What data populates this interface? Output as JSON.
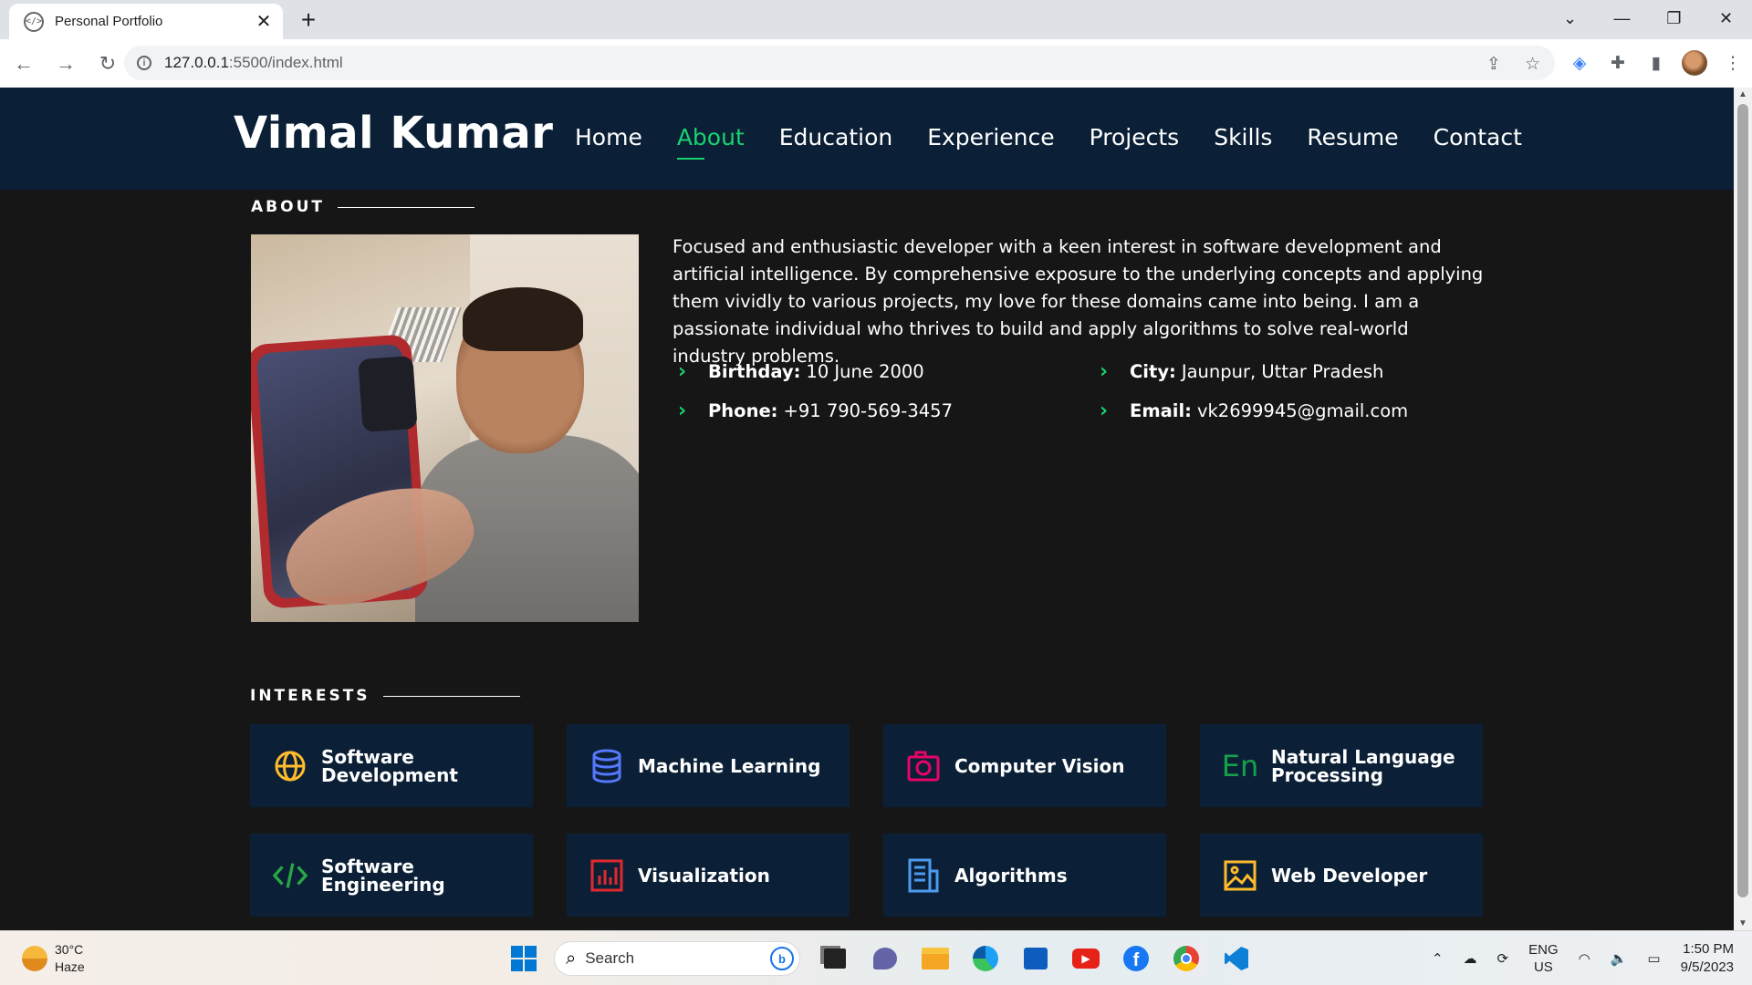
{
  "browser": {
    "tab_title": "Personal Portfolio",
    "tab_close": "✕",
    "new_tab": "+",
    "url_host": "127.0.0.1",
    "url_path": ":5500/index.html"
  },
  "site": {
    "brand": "Vimal Kumar",
    "nav": [
      {
        "label": "Home",
        "active": false
      },
      {
        "label": "About",
        "active": true
      },
      {
        "label": "Education",
        "active": false
      },
      {
        "label": "Experience",
        "active": false
      },
      {
        "label": "Projects",
        "active": false
      },
      {
        "label": "Skills",
        "active": false
      },
      {
        "label": "Resume",
        "active": false
      },
      {
        "label": "Contact",
        "active": false
      }
    ],
    "accent_color": "#18d26e",
    "header_color": "#0b2036"
  },
  "about": {
    "section_title": "ABOUT",
    "bio": "Focused and enthusiastic developer with a keen interest in software development and artificial intelligence. By comprehensive exposure to the underlying concepts and applying them vividly to various projects, my love for these domains came into being. I am a passionate individual who thrives to build and apply algorithms to solve real-world industry problems.",
    "info": [
      {
        "label": "Birthday:",
        "value": "10 June 2000"
      },
      {
        "label": "City:",
        "value": "Jaunpur, Uttar Pradesh"
      },
      {
        "label": "Phone:",
        "value": "+91 790-569-3457"
      },
      {
        "label": "Email:",
        "value": "vk2699945@gmail.com"
      }
    ]
  },
  "interests": {
    "section_title": "INTERESTS",
    "items": [
      {
        "label_1": "Software",
        "label_2": "Development",
        "icon": "globe-icon",
        "color": "#ffbb2c"
      },
      {
        "label_1": "Machine Learning",
        "label_2": "",
        "icon": "database-icon",
        "color": "#5578ff"
      },
      {
        "label_1": "Computer Vision",
        "label_2": "",
        "icon": "camera-icon",
        "color": "#e80368"
      },
      {
        "label_1": "Natural Language",
        "label_2": "Processing",
        "icon": "language-icon",
        "color": "#15a04a"
      },
      {
        "label_1": "Software",
        "label_2": "Engineering",
        "icon": "code-icon",
        "color": "#28a745"
      },
      {
        "label_1": "Visualization",
        "label_2": "",
        "icon": "bar-chart-icon",
        "color": "#e1282e"
      },
      {
        "label_1": "Algorithms",
        "label_2": "",
        "icon": "document-icon",
        "color": "#4d9bef"
      },
      {
        "label_1": "Web Developer",
        "label_2": "",
        "icon": "image-icon",
        "color": "#ffbb2c"
      }
    ]
  },
  "taskbar": {
    "temp": "30°C",
    "condition": "Haze",
    "search_label": "Search",
    "lang_1": "ENG",
    "lang_2": "US",
    "time": "1:50 PM",
    "date": "9/5/2023"
  }
}
